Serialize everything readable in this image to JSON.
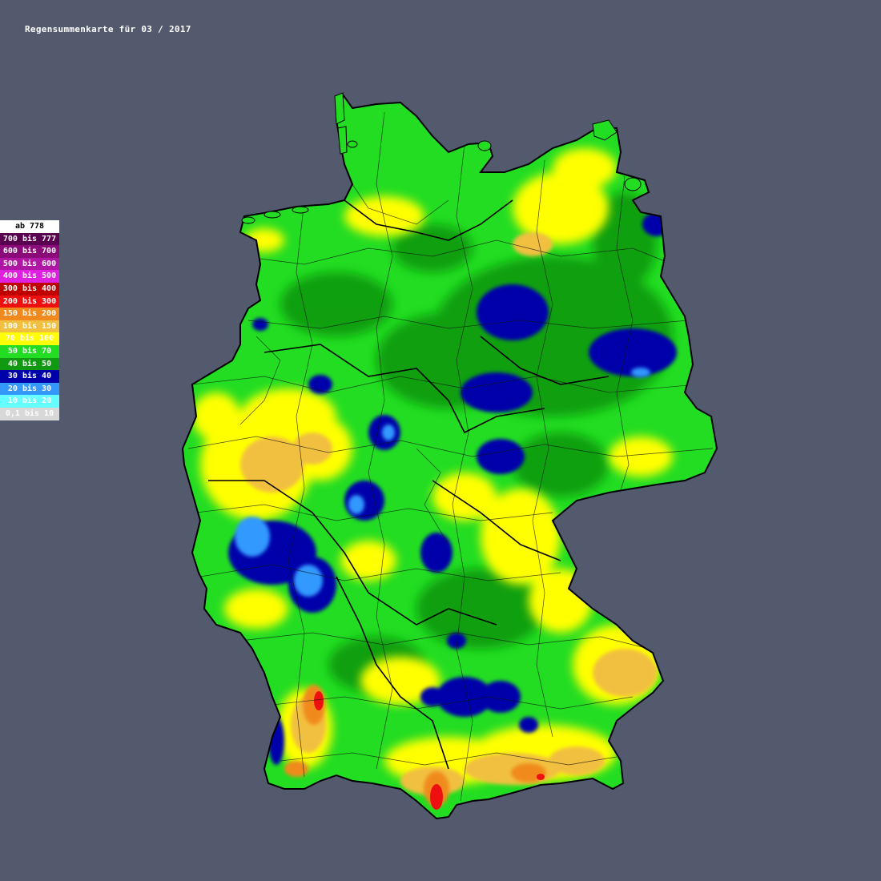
{
  "title": "Regensummenkarte für 03 / 2017",
  "legend": [
    {
      "label": "ab 778",
      "color": "#ffffff",
      "text": "#000000"
    },
    {
      "label": "700 bis 777",
      "color": "#5a0050",
      "text": "#ffffff"
    },
    {
      "label": "600 bis 700",
      "color": "#8a0a7a",
      "text": "#ffffff"
    },
    {
      "label": "500 bis 600",
      "color": "#b016a4",
      "text": "#ffffff"
    },
    {
      "label": "400 bis 500",
      "color": "#e020e0",
      "text": "#ffffff"
    },
    {
      "label": "300 bis 400",
      "color": "#c00000",
      "text": "#ffffff"
    },
    {
      "label": "200 bis 300",
      "color": "#ee1010",
      "text": "#ffffff"
    },
    {
      "label": "150 bis 200",
      "color": "#f08a1e",
      "text": "#ffffff"
    },
    {
      "label": "100 bis 150",
      "color": "#f2c040",
      "text": "#ffffff"
    },
    {
      "label": "70 bis 100",
      "color": "#ffff00",
      "text": "#ffffff"
    },
    {
      "label": "50 bis 70",
      "color": "#22dd22",
      "text": "#ffffff"
    },
    {
      "label": "40 bis 50",
      "color": "#119911",
      "text": "#ffffff"
    },
    {
      "label": "30 bis 40",
      "color": "#0000aa",
      "text": "#ffffff"
    },
    {
      "label": "20 bis 30",
      "color": "#3399ff",
      "text": "#ffffff"
    },
    {
      "label": "10 bis 20",
      "color": "#66ffff",
      "text": "#ffffff"
    },
    {
      "label": "0,1 bis 10",
      "color": "#d8d8d8",
      "text": "#ffffff"
    }
  ]
}
